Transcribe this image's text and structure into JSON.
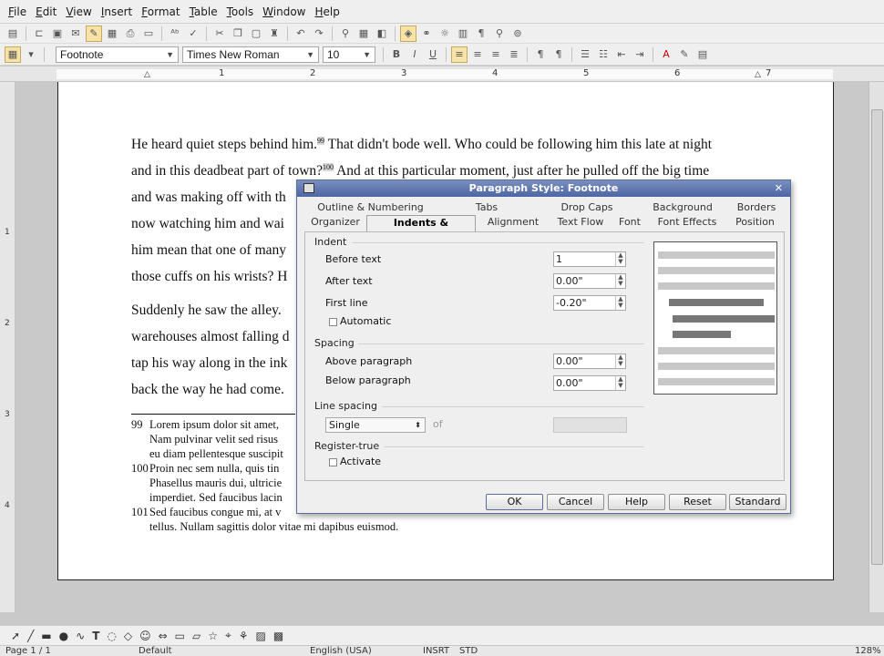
{
  "menubar": [
    "File",
    "Edit",
    "View",
    "Insert",
    "Format",
    "Table",
    "Tools",
    "Window",
    "Help"
  ],
  "formatting": {
    "style": "Footnote",
    "font": "Times New Roman",
    "size": "10"
  },
  "ruler": {
    "marks": [
      "1",
      "2",
      "3",
      "4",
      "5",
      "6",
      "7"
    ],
    "vmarks": [
      "1",
      "2",
      "3",
      "4"
    ]
  },
  "document": {
    "lines": [
      [
        "He heard quiet steps behind him.",
        "99",
        " That didn't bode well. Who could be following him this late at night"
      ],
      [
        "and in this deadbeat part of town?",
        "100",
        " And at this particular moment, just after he pulled off the big time"
      ],
      [
        "and was making off with th",
        "",
        ""
      ],
      [
        "now watching him and wai",
        "",
        ""
      ],
      [
        "him mean that one of many",
        "",
        ""
      ],
      [
        "those cuffs on his wrists? H",
        "",
        ""
      ]
    ],
    "lines2": [
      "Suddenly he saw the alley.",
      "warehouses almost falling d",
      "tap his way along in the ink",
      "back the way he had come."
    ],
    "footnotes": [
      {
        "no": "99",
        "lines": [
          "Lorem ipsum dolor sit amet,",
          "Nam pulvinar velit sed risus",
          "eu diam pellentesque suscipit"
        ]
      },
      {
        "no": "100",
        "lines": [
          "Proin nec sem nulla, quis tin",
          "Phasellus mauris dui, ultricie",
          "imperdiet. Sed faucibus lacin"
        ]
      },
      {
        "no": "101",
        "lines": [
          "Sed faucibus congue mi, at v",
          "tellus. Nullam sagittis dolor vitae mi dapibus euismod."
        ]
      }
    ]
  },
  "dialog": {
    "title": "Paragraph Style: Footnote",
    "tabs_row1": [
      "Outline & Numbering",
      "Tabs",
      "Drop Caps",
      "Background",
      "Borders"
    ],
    "tabs_row2": [
      "Organizer",
      "Indents & Spacing",
      "Alignment",
      "Text Flow",
      "Font",
      "Font Effects",
      "Position"
    ],
    "active_tab": "Indents & Spacing",
    "indent": {
      "heading": "Indent",
      "before_label": "Before text",
      "before_value": "1",
      "after_label": "After text",
      "after_value": "0.00\"",
      "first_label": "First line",
      "first_value": "-0.20\"",
      "automatic_label": "Automatic"
    },
    "spacing": {
      "heading": "Spacing",
      "above_label": "Above paragraph",
      "above_value": "0.00\"",
      "below_label": "Below paragraph",
      "below_value": "0.00\""
    },
    "line_spacing": {
      "heading": "Line spacing",
      "value": "Single",
      "of_label": "of"
    },
    "register": {
      "heading": "Register-true",
      "activate_label": "Activate"
    },
    "buttons": [
      "OK",
      "Cancel",
      "Help",
      "Reset",
      "Standard"
    ]
  },
  "status": {
    "page": "Page 1 / 1",
    "style": "Default",
    "language": "English (USA)",
    "insert": "INSRT",
    "std": "STD",
    "zoom": "128%"
  },
  "colors": {
    "titlebar": "#4d66a3",
    "highlight": "#f7e3a6"
  }
}
